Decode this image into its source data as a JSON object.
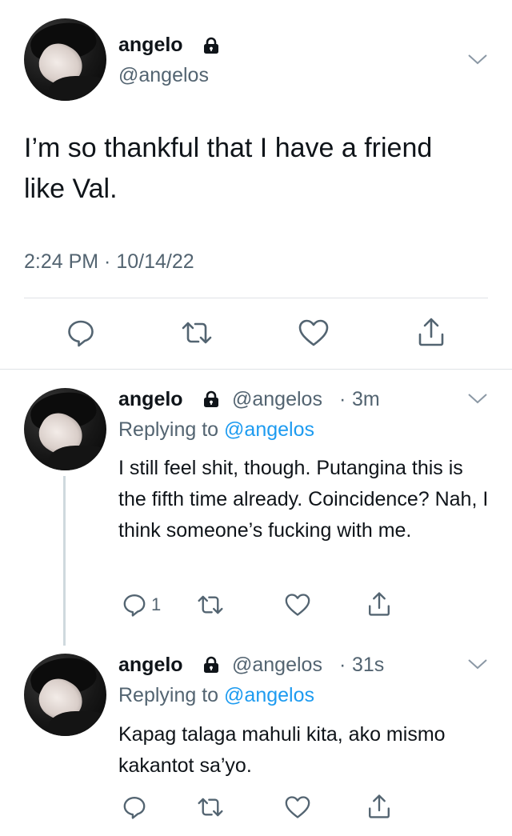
{
  "main_tweet": {
    "name": "angelo",
    "handle": "@angelos",
    "text": "I’m so thankful that I have a friend like Val.",
    "timestamp": "2:24 PM · 10/14/22"
  },
  "replies": [
    {
      "name": "angelo",
      "handle": "@angelos",
      "time": "3m",
      "replying_label": "Replying to",
      "replying_to": "@angelos",
      "text": "I still feel shit, though. Putangina this is the fifth time already. Coincidence? Nah, I think someone’s fucking with me.",
      "reply_count": "1"
    },
    {
      "name": "angelo",
      "handle": "@angelos",
      "time": "31s",
      "replying_label": "Replying to",
      "replying_to": "@angelos",
      "text": "Kapag talaga mahuli kita, ako mismo kakantot sa’yo."
    }
  ],
  "icons": [
    "lock-icon",
    "chevron-down-icon",
    "reply-icon",
    "retweet-icon",
    "like-icon",
    "share-icon"
  ],
  "colors": {
    "text": "#0f1419",
    "secondary": "#536471",
    "link": "#1d9bf0",
    "divider": "#dfe3e7"
  }
}
